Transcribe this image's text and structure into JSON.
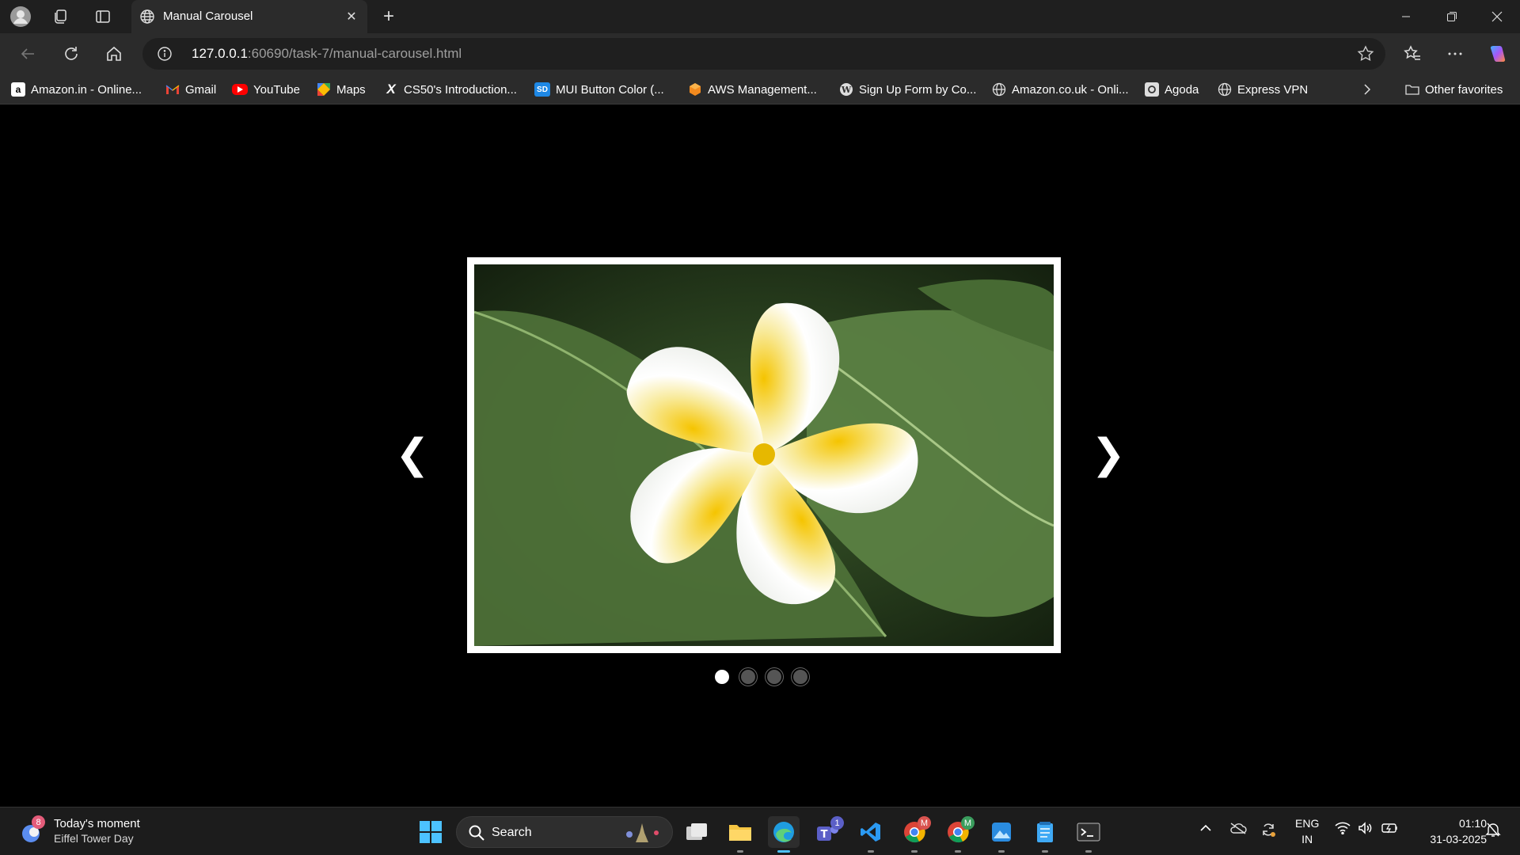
{
  "browser": {
    "tab_title": "Manual Carousel",
    "url_host": "127.0.0.1",
    "url_path": ":60690/task-7/manual-carousel.html"
  },
  "bookmarks": [
    {
      "label": "Amazon.in - Online...",
      "icon": "amazon-icon",
      "color": "#ffffff"
    },
    {
      "label": "Gmail",
      "icon": "gmail-icon",
      "color": "#ea4335"
    },
    {
      "label": "YouTube",
      "icon": "youtube-icon",
      "color": "#ff0000"
    },
    {
      "label": "Maps",
      "icon": "maps-icon",
      "color": "#34a853"
    },
    {
      "label": "CS50's Introduction...",
      "icon": "x-icon",
      "color": "#ffffff"
    },
    {
      "label": "MUI Button Color (...",
      "icon": "sd-icon",
      "color": "#1e88e5"
    },
    {
      "label": "AWS Management...",
      "icon": "aws-icon",
      "color": "#f28a1e"
    },
    {
      "label": "Sign Up Form by Co...",
      "icon": "wordpress-icon",
      "color": "#dddddd"
    },
    {
      "label": "Amazon.co.uk - Onli...",
      "icon": "globe-icon",
      "color": "#dddddd"
    },
    {
      "label": "Agoda",
      "icon": "agoda-icon",
      "color": "#dddddd"
    },
    {
      "label": "Express VPN",
      "icon": "globe-icon",
      "color": "#dddddd"
    }
  ],
  "other_favorites": "Other favorites",
  "carousel": {
    "prev_glyph": "❮",
    "next_glyph": "❯",
    "slide_count": 4,
    "active_index": 0
  },
  "taskbar": {
    "widget_title": "Today's moment",
    "widget_subtitle": "Eiffel Tower Day",
    "widget_badge": "8",
    "search_placeholder": "Search",
    "teams_badge": "1",
    "chrome_badge_1": "M",
    "chrome_badge_2": "M",
    "lang_line1": "ENG",
    "lang_line2": "IN",
    "time": "01:10",
    "date": "31-03-2025"
  }
}
